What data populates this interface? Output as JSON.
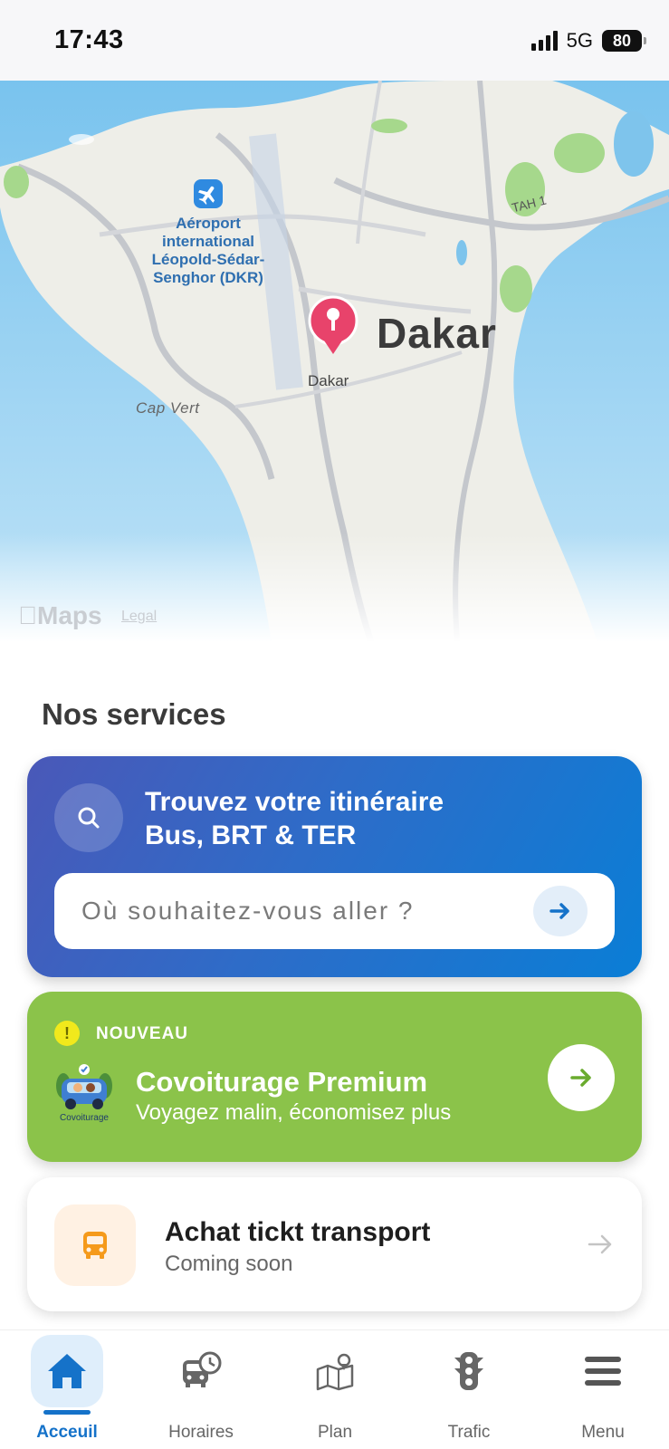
{
  "status": {
    "time": "17:43",
    "network": "5G",
    "battery": "80"
  },
  "map": {
    "airport_label": "Aéroport international Léopold-Sédar-Senghor (DKR)",
    "city_label": "Dakar",
    "pin_label": "Dakar",
    "cape_label": "Cap Vert",
    "road_label": "TAH 1",
    "maps_logo": "Maps",
    "legal": "Legal"
  },
  "services": {
    "title": "Nos services",
    "route": {
      "title_line1": "Trouvez votre itinéraire",
      "title_line2": "Bus, BRT & TER",
      "placeholder": "Où souhaitez-vous aller ?"
    },
    "carpool": {
      "badge": "NOUVEAU",
      "illustration_label": "Covoiturage",
      "title": "Covoiturage Premium",
      "subtitle": "Voyagez malin, économisez plus"
    },
    "ticket": {
      "title": "Achat tickt transport",
      "subtitle": "Coming soon"
    }
  },
  "tabs": [
    {
      "label": "Acceuil",
      "icon": "home-icon",
      "active": true
    },
    {
      "label": "Horaires",
      "icon": "bus-clock-icon",
      "active": false
    },
    {
      "label": "Plan",
      "icon": "map-pin-icon",
      "active": false
    },
    {
      "label": "Trafic",
      "icon": "traffic-light-icon",
      "active": false
    },
    {
      "label": "Menu",
      "icon": "menu-icon",
      "active": false
    }
  ],
  "colors": {
    "accent": "#1572c9",
    "route_card": "#0a7ed6",
    "carpool_card": "#8bc34a",
    "ticket_icon": "#f59a1b",
    "pin": "#e8436b"
  }
}
